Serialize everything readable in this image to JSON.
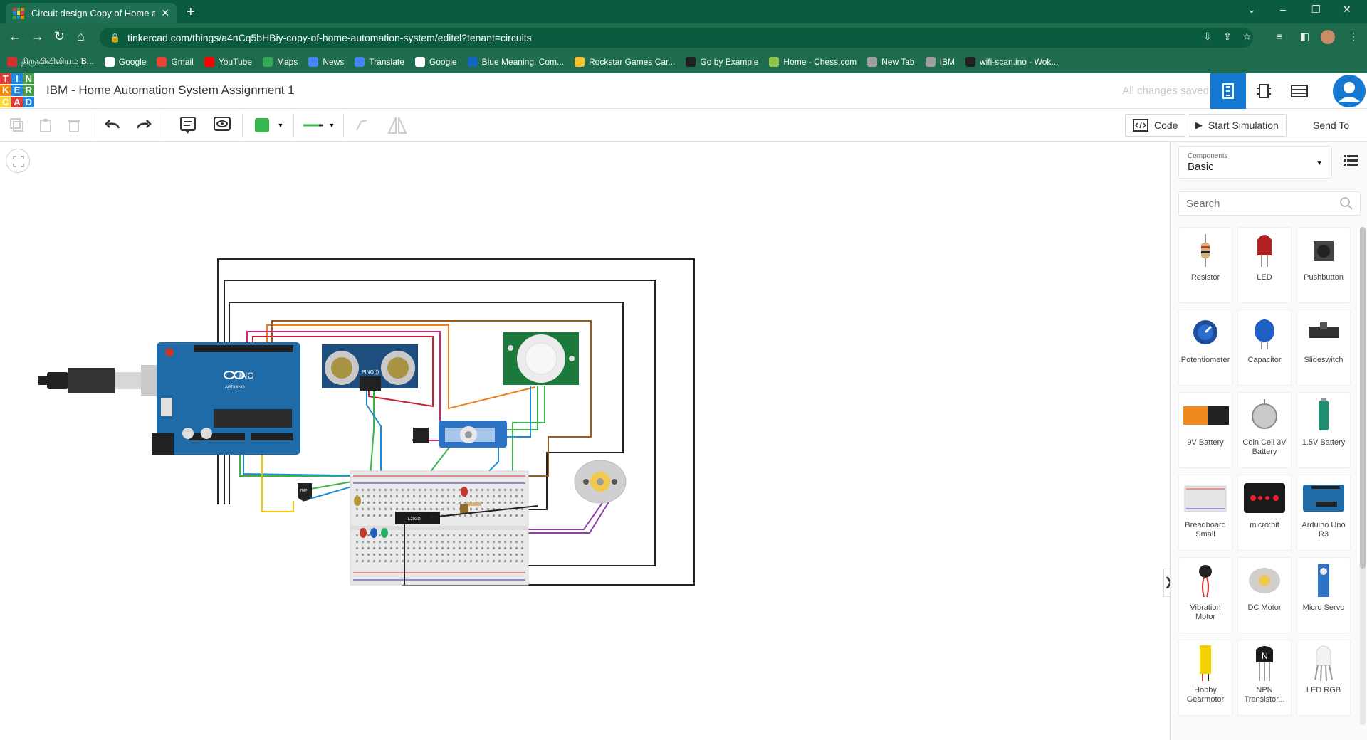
{
  "browser": {
    "tab_title": "Circuit design Copy of Home aut",
    "url": "tinkercad.com/things/a4nCq5bHBiy-copy-of-home-automation-system/editel?tenant=circuits",
    "bookmarks": [
      {
        "label": "திருவிவிலியம் B...",
        "color": "#d32f2f"
      },
      {
        "label": "Google",
        "color": "#ffffff"
      },
      {
        "label": "Gmail",
        "color": "#ea4335"
      },
      {
        "label": "YouTube",
        "color": "#ff0000"
      },
      {
        "label": "Maps",
        "color": "#34a853"
      },
      {
        "label": "News",
        "color": "#4285f4"
      },
      {
        "label": "Translate",
        "color": "#4285f4"
      },
      {
        "label": "Google",
        "color": "#ffffff"
      },
      {
        "label": "Blue Meaning, Com...",
        "color": "#1565c0"
      },
      {
        "label": "Rockstar Games Car...",
        "color": "#fbc02d"
      },
      {
        "label": "Go by Example",
        "color": "#212121"
      },
      {
        "label": "Home - Chess.com",
        "color": "#8bc34a"
      },
      {
        "label": "New Tab",
        "color": "#9e9e9e"
      },
      {
        "label": "IBM",
        "color": "#9e9e9e"
      },
      {
        "label": "wifi-scan.ino - Wok...",
        "color": "#212121"
      }
    ]
  },
  "header": {
    "logo_letters": [
      "T",
      "I",
      "N",
      "K",
      "E",
      "R",
      "C",
      "A",
      "D"
    ],
    "title": "IBM - Home Automation System Assignment 1",
    "save_status": "All changes saved"
  },
  "toolbar": {
    "code_label": "Code",
    "start_sim_label": "Start Simulation",
    "send_to_label": "Send To",
    "color_swatch": "#3ab54a"
  },
  "canvas": {
    "l293d_label": "L293D",
    "uno_label": "UNO",
    "arduino_label": "ARDUINO",
    "ping_label": "PING)))",
    "tmp_label": "TMP"
  },
  "panel": {
    "components_label": "Components",
    "components_value": "Basic",
    "search_placeholder": "Search",
    "items": [
      {
        "label": "Resistor",
        "icon": "resistor-icon"
      },
      {
        "label": "LED",
        "icon": "led-icon"
      },
      {
        "label": "Pushbutton",
        "icon": "pushbutton-icon"
      },
      {
        "label": "Potentiometer",
        "icon": "potentiometer-icon"
      },
      {
        "label": "Capacitor",
        "icon": "capacitor-icon"
      },
      {
        "label": "Slideswitch",
        "icon": "slideswitch-icon"
      },
      {
        "label": "9V Battery",
        "icon": "battery-9v-icon"
      },
      {
        "label": "Coin Cell 3V Battery",
        "icon": "coin-cell-icon"
      },
      {
        "label": "1.5V Battery",
        "icon": "battery-aa-icon"
      },
      {
        "label": "Breadboard Small",
        "icon": "breadboard-icon"
      },
      {
        "label": "micro:bit",
        "icon": "microbit-icon"
      },
      {
        "label": "Arduino Uno R3",
        "icon": "arduino-icon"
      },
      {
        "label": "Vibration Motor",
        "icon": "vibration-motor-icon"
      },
      {
        "label": "DC Motor",
        "icon": "dc-motor-icon"
      },
      {
        "label": "Micro Servo",
        "icon": "micro-servo-icon"
      },
      {
        "label": "Hobby Gearmotor",
        "icon": "gearmotor-icon"
      },
      {
        "label": "NPN Transistor...",
        "icon": "npn-transistor-icon"
      },
      {
        "label": "LED RGB",
        "icon": "led-rgb-icon"
      }
    ]
  }
}
